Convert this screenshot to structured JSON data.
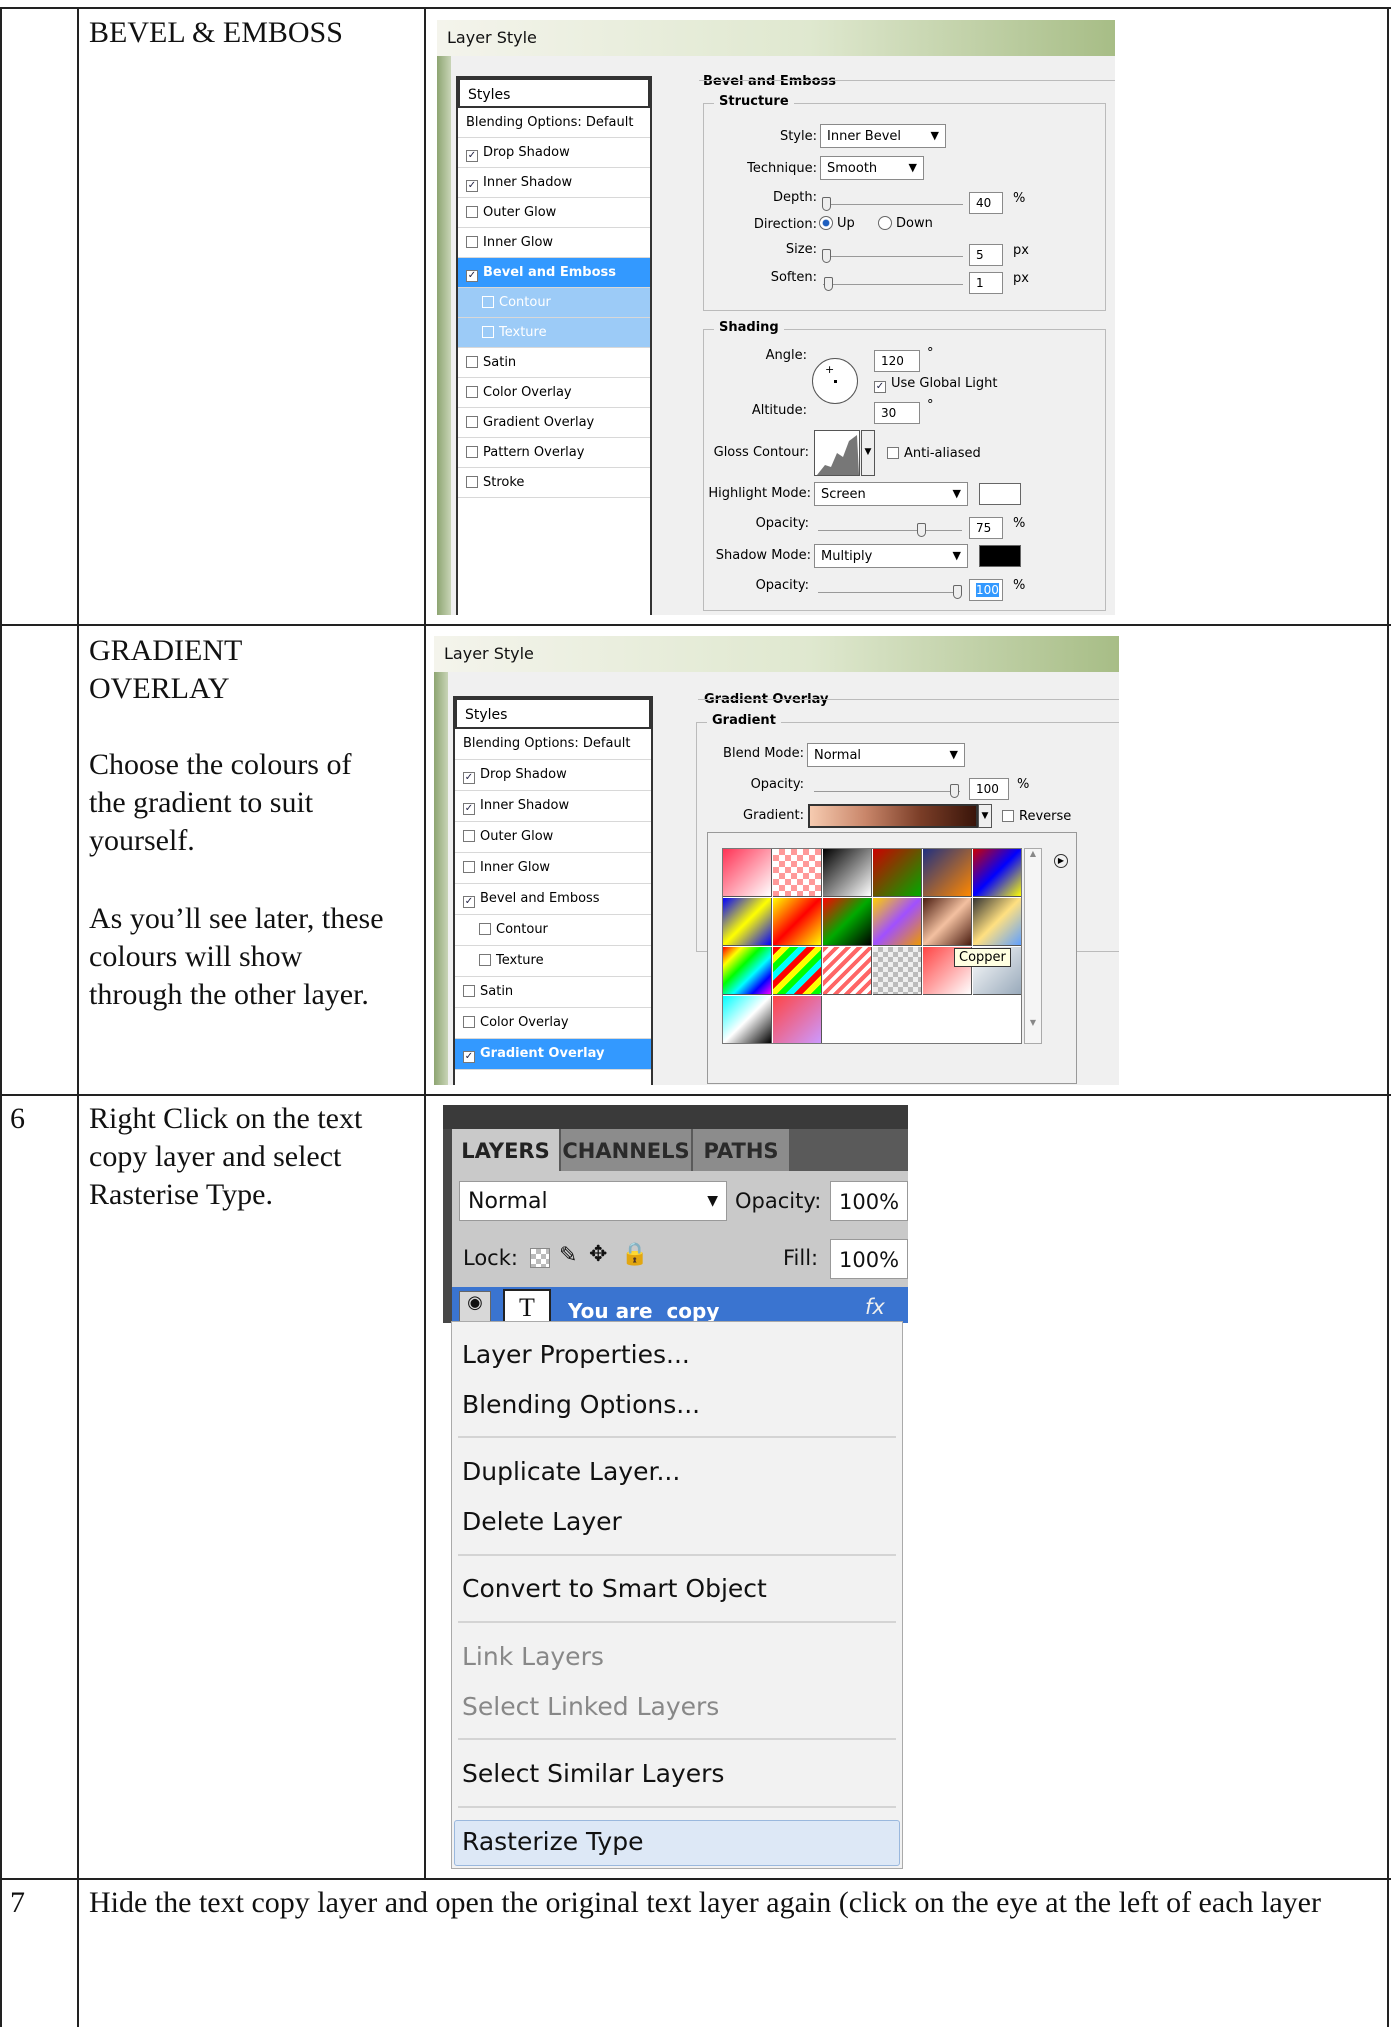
{
  "rows": [
    {
      "num": "",
      "title": "BEVEL & EMBOSS"
    },
    {
      "num": "",
      "title": "GRADIENT OVERLAY",
      "text1": "Choose the colours of the gradient to suit yourself.",
      "text2": "As you’ll see later, these colours will show through the other layer."
    },
    {
      "num": "6",
      "text": "Right Click on the text copy layer and select Rasterise Type."
    },
    {
      "num": "7",
      "text": "Hide the text copy layer and open the original text layer again (click on the eye at the left of each layer"
    }
  ],
  "bevel_dialog": {
    "title": "Layer Style",
    "styles": [
      {
        "label": "Styles",
        "checked": null,
        "state": "header"
      },
      {
        "label": "Blending Options: Default",
        "checked": null,
        "state": "normal"
      },
      {
        "label": "Drop Shadow",
        "checked": true,
        "state": "normal"
      },
      {
        "label": "Inner Shadow",
        "checked": true,
        "state": "normal"
      },
      {
        "label": "Outer Glow",
        "checked": false,
        "state": "normal"
      },
      {
        "label": "Inner Glow",
        "checked": false,
        "state": "normal"
      },
      {
        "label": "Bevel and Emboss",
        "checked": true,
        "state": "selected"
      },
      {
        "label": "Contour",
        "checked": false,
        "state": "sub"
      },
      {
        "label": "Texture",
        "checked": false,
        "state": "sub"
      },
      {
        "label": "Satin",
        "checked": false,
        "state": "normal"
      },
      {
        "label": "Color Overlay",
        "checked": false,
        "state": "normal"
      },
      {
        "label": "Gradient Overlay",
        "checked": false,
        "state": "normal"
      },
      {
        "label": "Pattern Overlay",
        "checked": false,
        "state": "normal"
      },
      {
        "label": "Stroke",
        "checked": false,
        "state": "normal"
      }
    ],
    "section": "Bevel and Emboss",
    "structure": {
      "title": "Structure",
      "style_label": "Style:",
      "style_value": "Inner Bevel",
      "technique_label": "Technique:",
      "technique_value": "Smooth",
      "depth_label": "Depth:",
      "depth_value": "40",
      "depth_unit": "%",
      "direction_label": "Direction:",
      "up_label": "Up",
      "down_label": "Down",
      "size_label": "Size:",
      "size_value": "5",
      "size_unit": "px",
      "soften_label": "Soften:",
      "soften_value": "1",
      "soften_unit": "px"
    },
    "shading": {
      "title": "Shading",
      "angle_label": "Angle:",
      "angle_value": "120",
      "degree": "°",
      "global_light_label": "Use Global Light",
      "altitude_label": "Altitude:",
      "altitude_value": "30",
      "gloss_label": "Gloss Contour:",
      "anti_aliased_label": "Anti-aliased",
      "highlight_mode_label": "Highlight Mode:",
      "highlight_mode_value": "Screen",
      "highlight_color": "#ffffff",
      "hl_opacity_label": "Opacity:",
      "hl_opacity_value": "75",
      "pct": "%",
      "shadow_mode_label": "Shadow Mode:",
      "shadow_mode_value": "Multiply",
      "shadow_color": "#000000",
      "sh_opacity_label": "Opacity:",
      "sh_opacity_value": "100"
    }
  },
  "gradient_dialog": {
    "title": "Layer Style",
    "styles": [
      {
        "label": "Styles",
        "checked": null,
        "state": "header"
      },
      {
        "label": "Blending Options: Default",
        "checked": null,
        "state": "normal"
      },
      {
        "label": "Drop Shadow",
        "checked": true,
        "state": "normal"
      },
      {
        "label": "Inner Shadow",
        "checked": true,
        "state": "normal"
      },
      {
        "label": "Outer Glow",
        "checked": false,
        "state": "normal"
      },
      {
        "label": "Inner Glow",
        "checked": false,
        "state": "normal"
      },
      {
        "label": "Bevel and Emboss",
        "checked": true,
        "state": "normal"
      },
      {
        "label": "Contour",
        "checked": false,
        "state": "indent"
      },
      {
        "label": "Texture",
        "checked": false,
        "state": "indent"
      },
      {
        "label": "Satin",
        "checked": false,
        "state": "normal"
      },
      {
        "label": "Color Overlay",
        "checked": false,
        "state": "normal"
      },
      {
        "label": "Gradient Overlay",
        "checked": true,
        "state": "selected"
      }
    ],
    "section": "Gradient Overlay",
    "group": "Gradient",
    "blend_mode_label": "Blend Mode:",
    "blend_mode_value": "Normal",
    "opacity_label": "Opacity:",
    "opacity_value": "100",
    "pct": "%",
    "gradient_label": "Gradient:",
    "reverse_label": "Reverse",
    "tooltip": "Copper"
  },
  "layers_panel": {
    "tabs": [
      "LAYERS",
      "CHANNELS",
      "PATHS"
    ],
    "blend_mode": "Normal",
    "opacity_label": "Opacity:",
    "opacity_value": "100%",
    "lock_label": "Lock:",
    "fill_label": "Fill:",
    "fill_value": "100%",
    "layer_name": "You are  copy",
    "fx": "fx",
    "thumb": "T"
  },
  "context_menu": {
    "items": [
      {
        "label": "Layer Properties...",
        "disabled": false
      },
      {
        "label": "Blending Options...",
        "disabled": false
      },
      {
        "label": "Duplicate Layer...",
        "disabled": false
      },
      {
        "label": "Delete Layer",
        "disabled": false
      },
      {
        "label": "Convert to Smart Object",
        "disabled": false
      },
      {
        "label": "Link Layers",
        "disabled": true
      },
      {
        "label": "Select Linked Layers",
        "disabled": true
      },
      {
        "label": "Select Similar Layers",
        "disabled": false
      },
      {
        "label": "Rasterize Type",
        "disabled": false
      }
    ]
  }
}
